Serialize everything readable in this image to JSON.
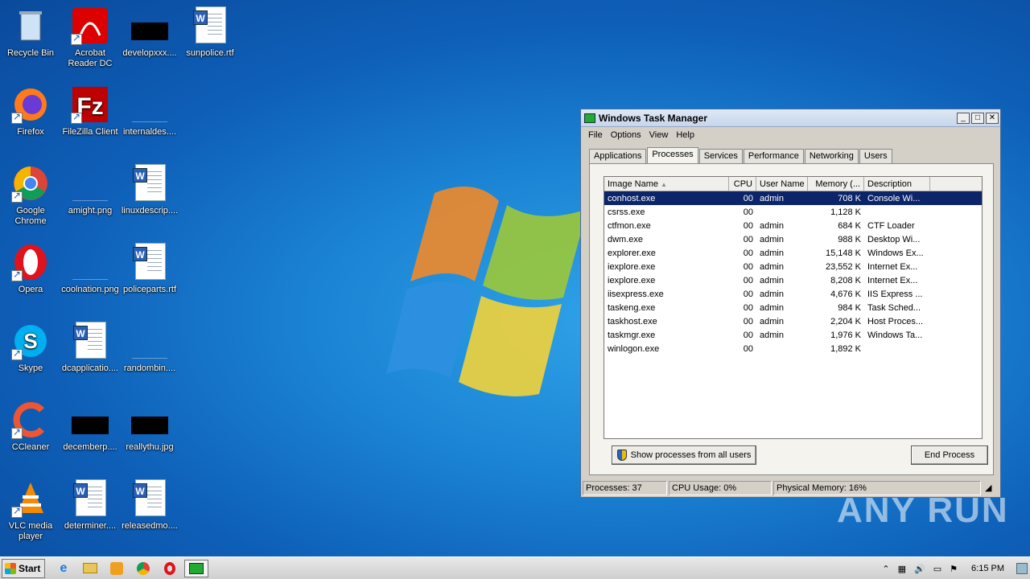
{
  "desktop": {
    "icons": [
      {
        "label": "Recycle Bin"
      },
      {
        "label": "Acrobat Reader DC"
      },
      {
        "label": "developxxx...."
      },
      {
        "label": "sunpolice.rtf"
      },
      {
        "label": "Firefox"
      },
      {
        "label": "FileZilla Client"
      },
      {
        "label": "internaldes...."
      },
      {
        "label": "Google Chrome"
      },
      {
        "label": "amight.png"
      },
      {
        "label": "linuxdescrip...."
      },
      {
        "label": "Opera"
      },
      {
        "label": "coolnation.png"
      },
      {
        "label": "policeparts.rtf"
      },
      {
        "label": "Skype"
      },
      {
        "label": "dcapplicatio...."
      },
      {
        "label": "randombin...."
      },
      {
        "label": "CCleaner"
      },
      {
        "label": "decemberp...."
      },
      {
        "label": "reallythu.jpg"
      },
      {
        "label": "VLC media player"
      },
      {
        "label": "determiner...."
      },
      {
        "label": "releasedmo...."
      }
    ]
  },
  "task_manager": {
    "title": "Windows Task Manager",
    "menu": [
      "File",
      "Options",
      "View",
      "Help"
    ],
    "tabs": [
      "Applications",
      "Processes",
      "Services",
      "Performance",
      "Networking",
      "Users"
    ],
    "active_tab": "Processes",
    "columns": [
      "Image Name",
      "CPU",
      "User Name",
      "Memory (...",
      "Description"
    ],
    "processes": [
      {
        "name": "conhost.exe",
        "cpu": "00",
        "user": "admin",
        "mem": "708 K",
        "desc": "Console Wi..."
      },
      {
        "name": "csrss.exe",
        "cpu": "00",
        "user": "",
        "mem": "1,128 K",
        "desc": ""
      },
      {
        "name": "ctfmon.exe",
        "cpu": "00",
        "user": "admin",
        "mem": "684 K",
        "desc": "CTF Loader"
      },
      {
        "name": "dwm.exe",
        "cpu": "00",
        "user": "admin",
        "mem": "988 K",
        "desc": "Desktop Wi..."
      },
      {
        "name": "explorer.exe",
        "cpu": "00",
        "user": "admin",
        "mem": "15,148 K",
        "desc": "Windows Ex..."
      },
      {
        "name": "iexplore.exe",
        "cpu": "00",
        "user": "admin",
        "mem": "23,552 K",
        "desc": "Internet Ex..."
      },
      {
        "name": "iexplore.exe",
        "cpu": "00",
        "user": "admin",
        "mem": "8,208 K",
        "desc": "Internet Ex..."
      },
      {
        "name": "iisexpress.exe",
        "cpu": "00",
        "user": "admin",
        "mem": "4,676 K",
        "desc": "IIS Express ..."
      },
      {
        "name": "taskeng.exe",
        "cpu": "00",
        "user": "admin",
        "mem": "984 K",
        "desc": "Task Sched..."
      },
      {
        "name": "taskhost.exe",
        "cpu": "00",
        "user": "admin",
        "mem": "2,204 K",
        "desc": "Host Proces..."
      },
      {
        "name": "taskmgr.exe",
        "cpu": "00",
        "user": "admin",
        "mem": "1,976 K",
        "desc": "Windows Ta..."
      },
      {
        "name": "winlogon.exe",
        "cpu": "00",
        "user": "",
        "mem": "1,892 K",
        "desc": ""
      }
    ],
    "show_all_label": "Show processes from all users",
    "end_process_label": "End Process",
    "status": {
      "processes": "Processes: 37",
      "cpu": "CPU Usage: 0%",
      "memory": "Physical Memory: 16%"
    }
  },
  "taskbar": {
    "start_label": "Start",
    "clock": "6:15 PM"
  },
  "watermark": "ANY RUN"
}
